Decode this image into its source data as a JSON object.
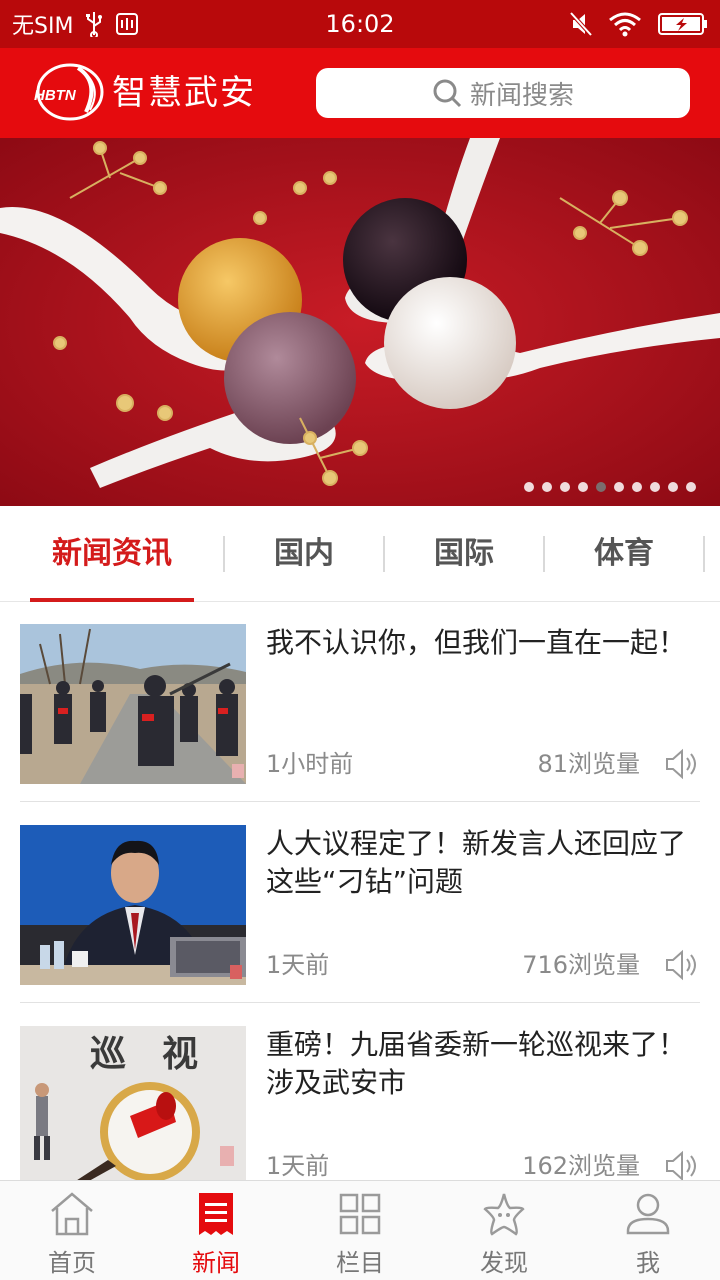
{
  "status_bar": {
    "carrier": "无SIM",
    "time": "16:02"
  },
  "header": {
    "logo_text": "HBTN",
    "title": "智慧武安",
    "search_placeholder": "新闻搜索"
  },
  "banner": {
    "slide_count": 10,
    "active_slide": 5
  },
  "tabs": [
    {
      "label": "新闻资讯",
      "active": true
    },
    {
      "label": "国内",
      "active": false
    },
    {
      "label": "国际",
      "active": false
    },
    {
      "label": "体育",
      "active": false
    }
  ],
  "news": [
    {
      "title": "我不认识你，但我们一直在一起！",
      "time": "1小时前",
      "views": "81浏览量"
    },
    {
      "title": "人大议程定了！新发言人还回应了这些“刁钻”问题",
      "time": "1天前",
      "views": "716浏览量"
    },
    {
      "title": "重磅！九届省委新一轮巡视来了！涉及武安市",
      "time": "1天前",
      "views": "162浏览量",
      "thumb_text": "巡　视"
    }
  ],
  "bottom_nav": [
    {
      "label": "首页",
      "icon": "home-icon",
      "active": false
    },
    {
      "label": "新闻",
      "icon": "news-icon",
      "active": true
    },
    {
      "label": "栏目",
      "icon": "grid-icon",
      "active": false
    },
    {
      "label": "发现",
      "icon": "star-icon",
      "active": false
    },
    {
      "label": "我",
      "icon": "user-icon",
      "active": false
    }
  ],
  "colors": {
    "brand_red": "#e50b0e",
    "status_red": "#b8090b",
    "active_tab": "#d41b1b"
  }
}
